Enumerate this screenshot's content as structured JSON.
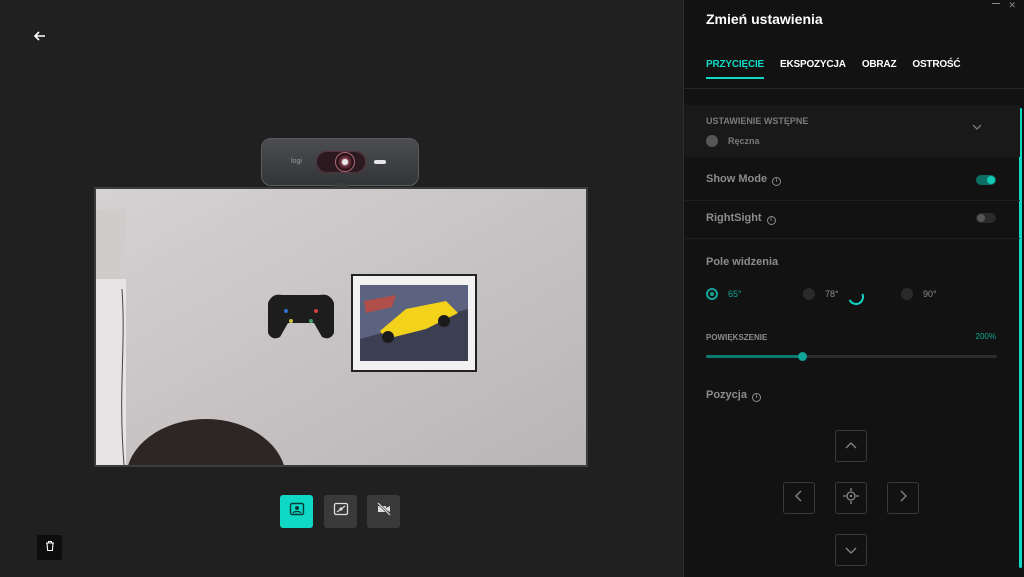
{
  "panel": {
    "title": "Zmień ustawienia",
    "tabs": [
      {
        "label": "PRZYCIĘCIE",
        "active": true
      },
      {
        "label": "EKSPOZYCJA",
        "active": false
      },
      {
        "label": "OBRAZ",
        "active": false
      },
      {
        "label": "OSTROŚĆ",
        "active": false
      }
    ]
  },
  "preset": {
    "label": "USTAWIENIE WSTĘPNE",
    "value": "Ręczna"
  },
  "show_mode": {
    "label": "Show Mode",
    "enabled": true
  },
  "rightsight": {
    "label": "RightSight",
    "enabled": false
  },
  "fov": {
    "label": "Pole widzenia",
    "options": [
      "65°",
      "78°",
      "90°"
    ],
    "selected": "65°"
  },
  "zoom": {
    "label": "POWIĘKSZENIE",
    "value_text": "200%",
    "level": 0.33
  },
  "position": {
    "label": "Pozycja"
  },
  "camera": {
    "logo_text": "logi"
  },
  "colors": {
    "accent": "#0fd9c5",
    "background": "#202020",
    "panel": "#121212"
  }
}
